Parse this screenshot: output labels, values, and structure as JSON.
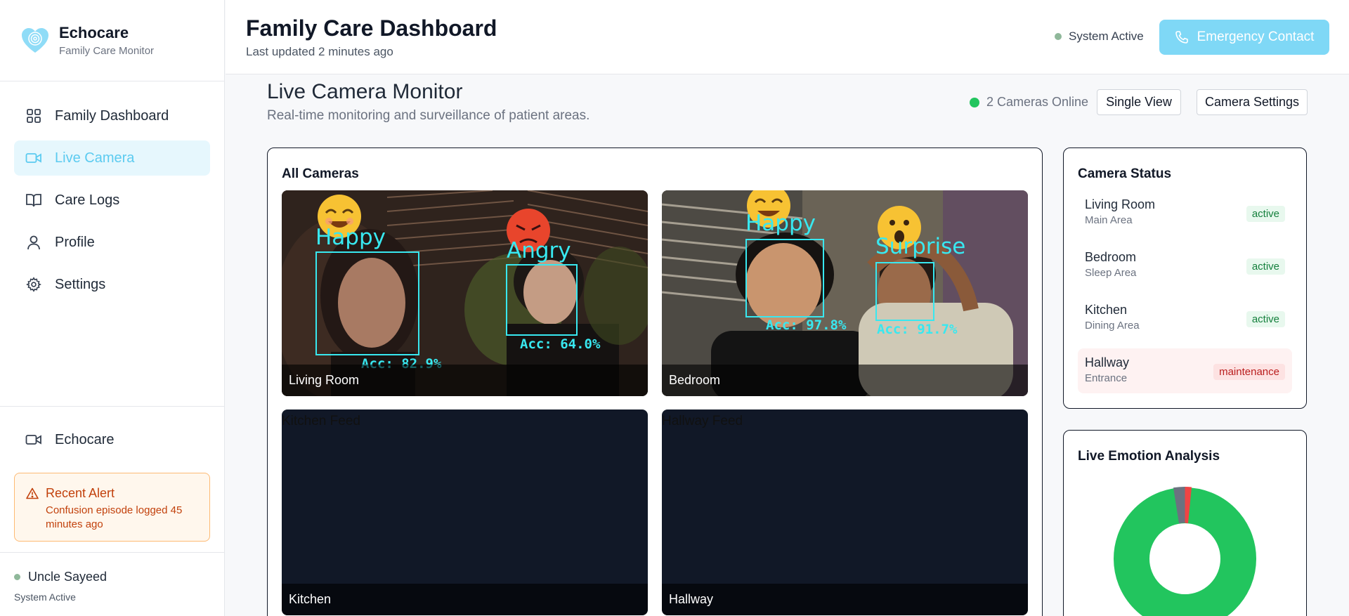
{
  "brand": {
    "name": "Echocare",
    "subtitle": "Family Care Monitor"
  },
  "nav": [
    {
      "label": "Family Dashboard",
      "icon": "grid-icon",
      "active": false
    },
    {
      "label": "Live Camera",
      "icon": "video-camera-icon",
      "active": true
    },
    {
      "label": "Care Logs",
      "icon": "book-icon",
      "active": false
    },
    {
      "label": "Profile",
      "icon": "user-icon",
      "active": false
    },
    {
      "label": "Settings",
      "icon": "gear-icon",
      "active": false
    }
  ],
  "sidebar_bottom": {
    "app_label": "Echocare",
    "alert": {
      "title": "Recent Alert",
      "text": "Confusion episode logged 45 minutes ago"
    },
    "user": {
      "name": "Uncle Sayeed",
      "status": "System Active"
    }
  },
  "header": {
    "title": "Family Care Dashboard",
    "subtitle": "Last updated 2 minutes ago",
    "system_status": "System Active",
    "emergency_label": "Emergency Contact"
  },
  "section": {
    "title": "Live Camera Monitor",
    "subtitle": "Real-time monitoring and surveillance of patient areas.",
    "cameras_online": "2 Cameras Online",
    "single_view_label": "Single View",
    "camera_settings_label": "Camera Settings"
  },
  "cameras": {
    "title": "All Cameras",
    "feeds": [
      {
        "caption": "Living Room",
        "detections": [
          {
            "emotion": "Happy",
            "acc": "Acc: 82.9%"
          },
          {
            "emotion": "Angry",
            "acc": "Acc: 64.0%"
          }
        ]
      },
      {
        "caption": "Bedroom",
        "detections": [
          {
            "emotion": "Happy",
            "acc": "Acc: 97.8%"
          },
          {
            "emotion": "Surprise",
            "acc": "Acc: 91.7%"
          }
        ]
      },
      {
        "caption": "Kitchen",
        "placeholder": "Kitchen Feed"
      },
      {
        "caption": "Hallway",
        "placeholder": "Hallway Feed"
      }
    ]
  },
  "camera_status": {
    "title": "Camera Status",
    "items": [
      {
        "name": "Living Room",
        "area": "Main Area",
        "status": "active"
      },
      {
        "name": "Bedroom",
        "area": "Sleep Area",
        "status": "active"
      },
      {
        "name": "Kitchen",
        "area": "Dining Area",
        "status": "active"
      },
      {
        "name": "Hallway",
        "area": "Entrance",
        "status": "maintenance"
      }
    ]
  },
  "emotion_analysis": {
    "title": "Live Emotion Analysis",
    "colors": {
      "happy": "#22c55e",
      "neutral": "#6b7280",
      "angry": "#ef4444"
    }
  },
  "colors": {
    "accent": "#5ccbf0",
    "active_bg": "#e6f7fd",
    "online": "#22c55e",
    "alert": "#c2410c"
  }
}
